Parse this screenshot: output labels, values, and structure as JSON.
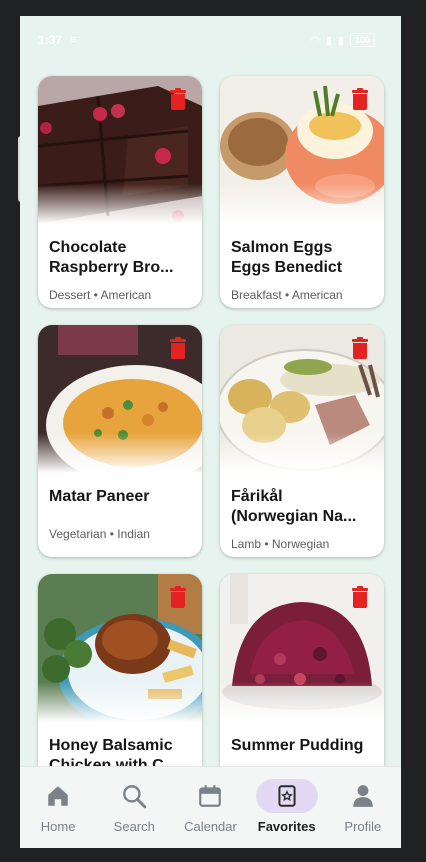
{
  "status_bar": {
    "time": "1:37",
    "battery": "100"
  },
  "favorites": [
    {
      "title": "Chocolate Raspberry Bro...",
      "meta": "Dessert • American",
      "image": "chocolate-brownie-photo"
    },
    {
      "title": "Salmon Eggs Eggs Benedict",
      "meta": "Breakfast • American",
      "image": "eggs-benedict-photo"
    },
    {
      "title": "Matar Paneer",
      "meta": "Vegetarian • Indian",
      "image": "curry-bowl-photo"
    },
    {
      "title": "Fårikål (Norwegian Na...",
      "meta": "Lamb • Norwegian",
      "image": "lamb-potatoes-photo"
    },
    {
      "title": "Honey Balsamic Chicken with C...",
      "meta": "",
      "image": "chicken-broccoli-photo"
    },
    {
      "title": "Summer Pudding",
      "meta": "",
      "image": "berry-pudding-photo"
    }
  ],
  "nav": {
    "items": [
      {
        "label": "Home",
        "icon": "home-icon"
      },
      {
        "label": "Search",
        "icon": "search-icon"
      },
      {
        "label": "Calendar",
        "icon": "calendar-icon"
      },
      {
        "label": "Favorites",
        "icon": "favorites-icon",
        "active": true
      },
      {
        "label": "Profile",
        "icon": "profile-icon"
      }
    ]
  },
  "colors": {
    "background": "#e6f3ee",
    "delete": "#e52222",
    "active_pill": "#e4d9f4"
  }
}
